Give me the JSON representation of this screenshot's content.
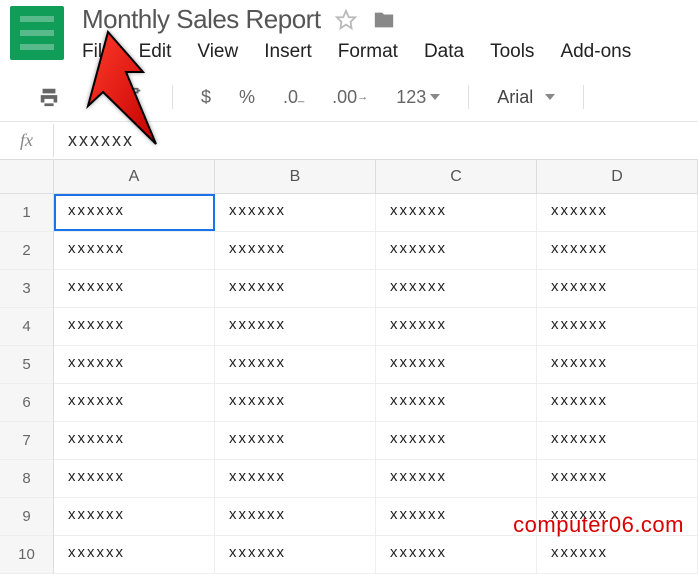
{
  "doc": {
    "title": "Monthly Sales Report"
  },
  "menu": {
    "file": "File",
    "edit": "Edit",
    "view": "View",
    "insert": "Insert",
    "format": "Format",
    "data": "Data",
    "tools": "Tools",
    "addons": "Add-ons"
  },
  "toolbar": {
    "currency": "$",
    "percent": "%",
    "dec_dec": ".0",
    "dec_inc": ".00",
    "more_formats": "123",
    "font": "Arial"
  },
  "formula": {
    "label": "fx",
    "value": "xxxxxx"
  },
  "columns": [
    "A",
    "B",
    "C",
    "D"
  ],
  "row_numbers": [
    "1",
    "2",
    "3",
    "4",
    "5",
    "6",
    "7",
    "8",
    "9",
    "10"
  ],
  "cells": {
    "value": "xxxxxx"
  },
  "watermark": "computer06.com"
}
